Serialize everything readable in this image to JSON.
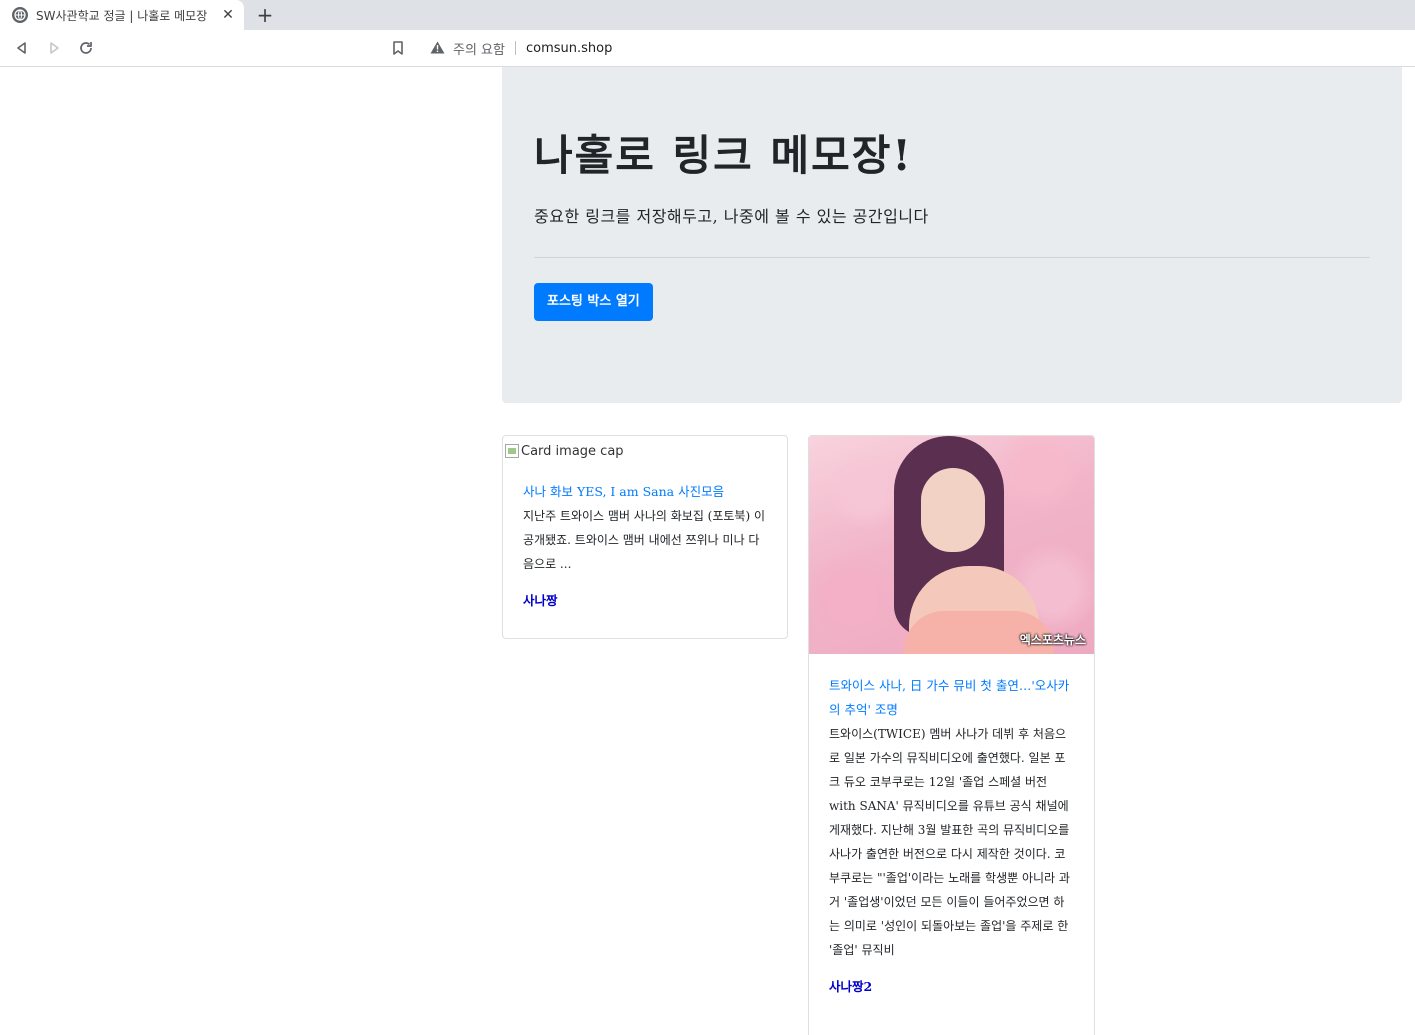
{
  "browser": {
    "tab_title": "SW사관학교 정글 | 나홀로 메모장",
    "tab_close": "✕",
    "new_tab": "+",
    "security_label": "주의 요함",
    "url": "comsun.shop",
    "icons": [
      "back-icon",
      "forward-icon",
      "reload-icon",
      "bookmark-icon",
      "warning-icon",
      "globe-icon"
    ]
  },
  "jumbotron": {
    "title": "나홀로 링크 메모장!",
    "lead": "중요한 링크를 저장해두고, 나중에 볼 수 있는 공간입니다",
    "button_label": "포스팅 박스 열기"
  },
  "cards": [
    {
      "image_alt": "Card image cap",
      "title": "사나 화보 YES, I am Sana 사진모음",
      "text": "지난주 트와이스 맴버 사나의 화보집 (포토북) 이 공개됐죠. 트와이스 맴버 내에선 쯔위나 미나 다음으로 ...",
      "comment": "사나짱"
    },
    {
      "image_watermark": "엑스포츠뉴스",
      "title": "트와이스 사나, 日 가수 뮤비 첫 출연…'오사카의 추억' 조명",
      "text": "트와이스(TWICE) 멤버 사나가 데뷔 후 처음으로 일본 가수의 뮤직비디오에 출연했다. 일본 포크 듀오 코부쿠로는 12일 '졸업 스페셜 버전 with SANA' 뮤직비디오를 유튜브 공식 채널에 게재했다. 지난해 3월 발표한 곡의 뮤직비디오를 사나가 출연한 버전으로 다시 제작한 것이다. 코부쿠로는 \"'졸업'이라는 노래를 학생뿐 아니라 과거 '졸업생'이었던 모든 이들이 들어주었으면 하는 의미로 '성인이 되돌아보는 졸업'을 주제로 한 '졸업' 뮤직비",
      "comment": "사나짱2"
    }
  ],
  "colors": {
    "primary": "#007bff",
    "jumbotron_bg": "#e9ecef",
    "comment_link": "#0000cc"
  }
}
